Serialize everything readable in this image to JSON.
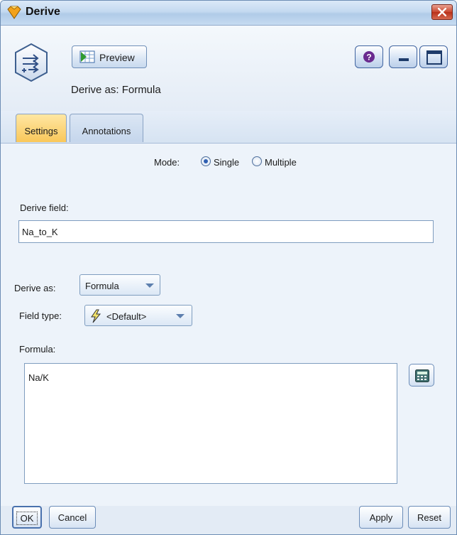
{
  "window": {
    "title": "Derive"
  },
  "toolbar": {
    "preview_label": "Preview",
    "derive_as_caption": "Derive as: Formula"
  },
  "tabs": [
    {
      "label": "Settings",
      "active": true
    },
    {
      "label": "Annotations",
      "active": false
    }
  ],
  "settings": {
    "mode_label": "Mode:",
    "mode_options": [
      "Single",
      "Multiple"
    ],
    "mode_selected": "Single",
    "derive_field_label": "Derive field:",
    "derive_field_value": "Na_to_K",
    "derive_as_label": "Derive as:",
    "derive_as_value": "Formula",
    "field_type_label": "Field type:",
    "field_type_value": "<Default>",
    "formula_label": "Formula:",
    "formula_value": "Na/K"
  },
  "footer": {
    "ok_label": "OK",
    "cancel_label": "Cancel",
    "apply_label": "Apply",
    "reset_label": "Reset"
  },
  "colors": {
    "active_tab": "#f9c75a",
    "close_button": "#c8462e",
    "accent": "#2e5fb2"
  }
}
